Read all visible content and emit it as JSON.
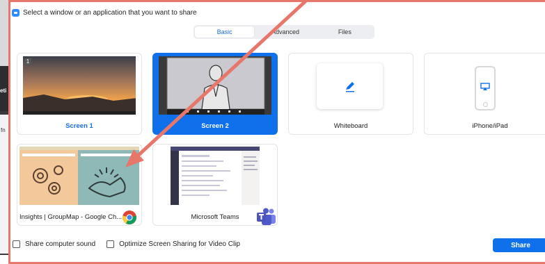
{
  "window": {
    "title": "Select a window or an application that you want to share"
  },
  "tabs": [
    {
      "label": "Basic",
      "active": true
    },
    {
      "label": "Advanced",
      "active": false
    },
    {
      "label": "Files",
      "active": false
    }
  ],
  "tiles": [
    {
      "label": "Screen 1",
      "badge": "1"
    },
    {
      "label": "Screen 2"
    },
    {
      "label": "Whiteboard",
      "icon": "pen-icon"
    },
    {
      "label": "iPhone/iPad",
      "icon": "airplay-icon"
    },
    {
      "label": "Insights | GroupMap - Google Ch...",
      "icon": "chrome-icon"
    },
    {
      "label": "Microsoft Teams",
      "icon": "teams-icon"
    }
  ],
  "background": {
    "window_text": "eti",
    "file_text": "fn"
  },
  "bottom": {
    "share_sound": "Share computer sound",
    "optimize": "Optimize Screen Sharing for Video Clip",
    "share_button": "Share"
  },
  "colors": {
    "accent": "#0e71eb",
    "annotation": "#e8776b"
  }
}
